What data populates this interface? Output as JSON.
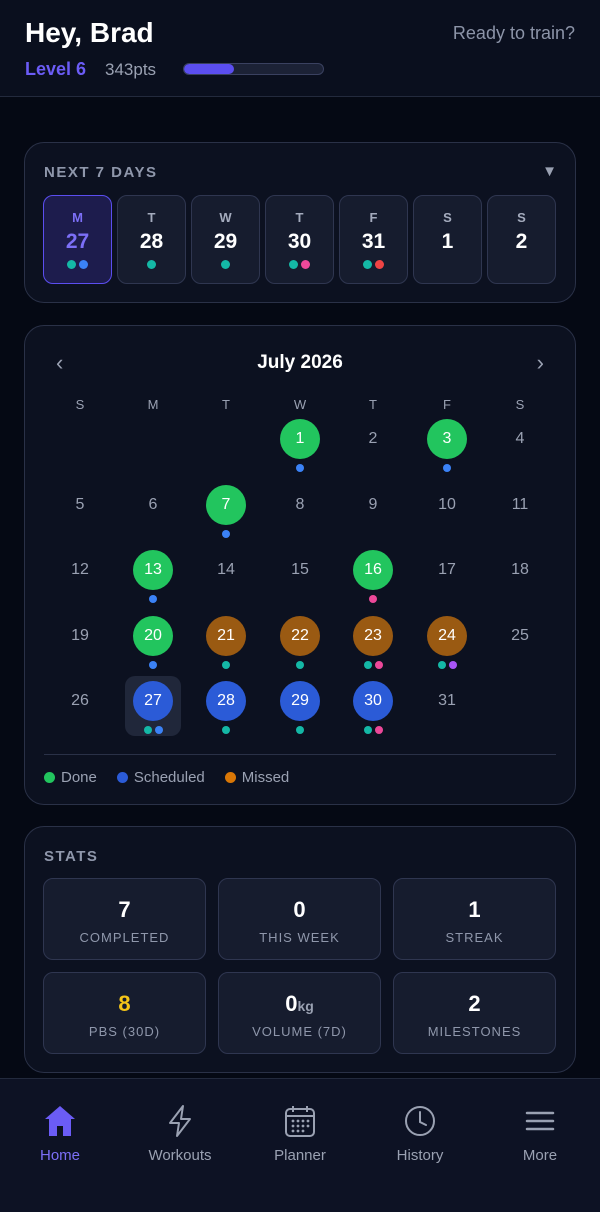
{
  "header": {
    "greeting": "Hey, Brad",
    "level": "Level 6",
    "points": "343pts",
    "xp_progress_percent": 36,
    "ready_text": "Ready to train?"
  },
  "colors": {
    "accent": "#5b4ef0",
    "done": "#22c55e",
    "scheduled": "#2b5bd7",
    "missed": "#9a5a12",
    "dot_teal": "#14b8a6",
    "dot_blue": "#3b82f6",
    "dot_pink": "#ec4899",
    "dot_red": "#ef4444",
    "dot_purple": "#a855f7",
    "gold": "#f5c518"
  },
  "next7": {
    "title": "NEXT 7 DAYS",
    "toggle_icon": "triangle-down-icon",
    "days": [
      {
        "dow": "M",
        "num": "27",
        "dots": [
          "teal",
          "blue"
        ],
        "active": true
      },
      {
        "dow": "T",
        "num": "28",
        "dots": [
          "teal"
        ]
      },
      {
        "dow": "W",
        "num": "29",
        "dots": [
          "teal"
        ]
      },
      {
        "dow": "T",
        "num": "30",
        "dots": [
          "teal",
          "pink"
        ]
      },
      {
        "dow": "F",
        "num": "31",
        "dots": [
          "teal",
          "red"
        ]
      },
      {
        "dow": "S",
        "num": "1",
        "dots": []
      },
      {
        "dow": "S",
        "num": "2",
        "dots": []
      }
    ]
  },
  "calendar": {
    "month": "July 2026",
    "prev_icon": "chevron-left-icon",
    "next_icon": "chevron-right-icon",
    "weekdays": [
      "S",
      "M",
      "T",
      "W",
      "T",
      "F",
      "S"
    ],
    "weeks": [
      [
        null,
        null,
        null,
        {
          "d": "1",
          "status": "done",
          "dots": [
            "blue"
          ]
        },
        {
          "d": "2"
        },
        {
          "d": "3",
          "status": "done",
          "dots": [
            "blue"
          ]
        },
        {
          "d": "4"
        }
      ],
      [
        {
          "d": "5"
        },
        {
          "d": "6"
        },
        {
          "d": "7",
          "status": "done",
          "dots": [
            "blue"
          ]
        },
        {
          "d": "8"
        },
        {
          "d": "9"
        },
        {
          "d": "10"
        },
        {
          "d": "11"
        }
      ],
      [
        {
          "d": "12"
        },
        {
          "d": "13",
          "status": "done",
          "dots": [
            "blue"
          ]
        },
        {
          "d": "14"
        },
        {
          "d": "15"
        },
        {
          "d": "16",
          "status": "done",
          "dots": [
            "pink"
          ]
        },
        {
          "d": "17"
        },
        {
          "d": "18"
        }
      ],
      [
        {
          "d": "19"
        },
        {
          "d": "20",
          "status": "done",
          "dots": [
            "blue"
          ]
        },
        {
          "d": "21",
          "status": "missed",
          "dots": [
            "teal"
          ]
        },
        {
          "d": "22",
          "status": "missed",
          "dots": [
            "teal"
          ]
        },
        {
          "d": "23",
          "status": "missed",
          "dots": [
            "teal",
            "pink"
          ]
        },
        {
          "d": "24",
          "status": "missed",
          "dots": [
            "teal",
            "purple"
          ]
        },
        {
          "d": "25"
        }
      ],
      [
        {
          "d": "26"
        },
        {
          "d": "27",
          "status": "scheduled",
          "dots": [
            "teal",
            "blue"
          ],
          "today": true
        },
        {
          "d": "28",
          "status": "scheduled",
          "dots": [
            "teal"
          ]
        },
        {
          "d": "29",
          "status": "scheduled",
          "dots": [
            "teal"
          ]
        },
        {
          "d": "30",
          "status": "scheduled",
          "dots": [
            "teal",
            "pink"
          ]
        },
        {
          "d": "31"
        },
        null
      ]
    ],
    "legend": [
      {
        "label": "Done",
        "color": "done"
      },
      {
        "label": "Scheduled",
        "color": "scheduled"
      },
      {
        "label": "Missed",
        "color": "missed"
      }
    ]
  },
  "stats": {
    "title": "STATS",
    "items": [
      {
        "value": "7",
        "label": "COMPLETED"
      },
      {
        "value": "0",
        "label": "THIS WEEK"
      },
      {
        "value": "1",
        "label": "STREAK"
      },
      {
        "value": "8",
        "label": "PBS (30D)",
        "highlight": true
      },
      {
        "value": "0",
        "unit": "kg",
        "label": "VOLUME (7D)"
      },
      {
        "value": "2",
        "label": "MILESTONES"
      }
    ]
  },
  "nav": {
    "items": [
      {
        "label": "Home",
        "icon": "home-icon",
        "active": true
      },
      {
        "label": "Workouts",
        "icon": "lightning-icon"
      },
      {
        "label": "Planner",
        "icon": "calendar-icon"
      },
      {
        "label": "History",
        "icon": "clock-icon"
      },
      {
        "label": "More",
        "icon": "menu-icon"
      }
    ]
  }
}
